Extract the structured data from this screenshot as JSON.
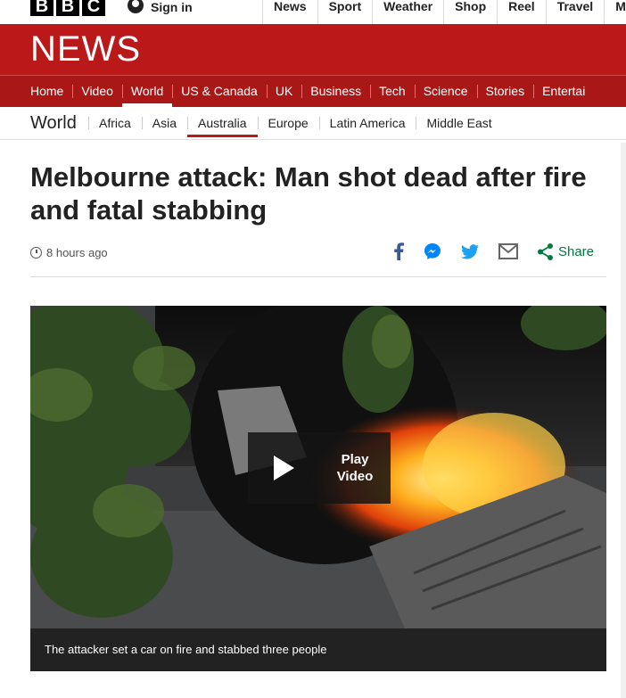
{
  "brand": {
    "letters": [
      "B",
      "B",
      "C"
    ]
  },
  "account": {
    "sign_in": "Sign in"
  },
  "top_links": [
    "News",
    "Sport",
    "Weather",
    "Shop",
    "Reel",
    "Travel",
    "More"
  ],
  "masthead": {
    "title": "NEWS"
  },
  "main_nav": [
    "Home",
    "Video",
    "World",
    "US & Canada",
    "UK",
    "Business",
    "Tech",
    "Science",
    "Stories",
    "Entertai"
  ],
  "main_nav_active": "World",
  "section": {
    "title": "World",
    "links": [
      "Africa",
      "Asia",
      "Australia",
      "Europe",
      "Latin America",
      "Middle East"
    ],
    "active": "Australia"
  },
  "article": {
    "headline": "Melbourne attack: Man shot dead after fire and fatal stabbing",
    "timestamp": "8 hours ago"
  },
  "share": {
    "icons": [
      "facebook-icon",
      "messenger-icon",
      "twitter-icon",
      "email-icon",
      "share-icon"
    ],
    "label": "Share",
    "colors": {
      "facebook": "#3b5998",
      "messenger": "#0084ff",
      "twitter": "#1da1f2",
      "email": "#666666",
      "share": "#007a3d"
    }
  },
  "video": {
    "play_label": "Play\nVideo",
    "caption": "The attacker set a car on fire and stabbed three people"
  },
  "colors": {
    "brand_red": "#bb1919",
    "nav_red": "#a91717"
  }
}
